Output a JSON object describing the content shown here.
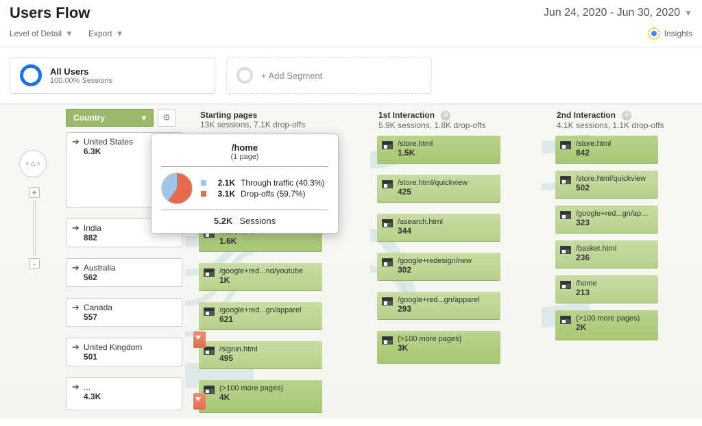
{
  "header": {
    "title": "Users Flow",
    "date_range": "Jun 24, 2020 - Jun 30, 2020"
  },
  "toolbar": {
    "level_of_detail": "Level of Detail",
    "export": "Export",
    "insights": "Insights"
  },
  "segments": {
    "all_users": "All Users",
    "all_users_sub": "100.00% Sessions",
    "add_segment": "+ Add Segment"
  },
  "dimension": {
    "label": "Country"
  },
  "sources": [
    {
      "name": "United States",
      "value": "6.3K"
    },
    {
      "name": "India",
      "value": "882"
    },
    {
      "name": "Australia",
      "value": "562"
    },
    {
      "name": "Canada",
      "value": "557"
    },
    {
      "name": "United Kingdom",
      "value": "501"
    },
    {
      "name": "...",
      "value": "4.3K"
    }
  ],
  "columns": {
    "start": {
      "title": "Starting pages",
      "sub": "13K sessions, 7.1K drop-offs",
      "items": [
        {
          "label": "/store.html",
          "value": "1.6K"
        },
        {
          "label": "/google+red...nd/youtube",
          "value": "1K"
        },
        {
          "label": "/google+red...gn/apparel",
          "value": "621"
        },
        {
          "label": "/signin.html",
          "value": "495"
        },
        {
          "label": "(>100 more pages)",
          "value": "4K"
        }
      ]
    },
    "first": {
      "title": "1st Interaction",
      "sub": "5.9K sessions, 1.8K drop-offs",
      "items": [
        {
          "label": "/store.html",
          "value": "1.5K"
        },
        {
          "label": "/store.html/quickview",
          "value": "425"
        },
        {
          "label": "/asearch.html",
          "value": "344"
        },
        {
          "label": "/google+redesign/new",
          "value": "302"
        },
        {
          "label": "/google+red...gn/apparel",
          "value": "293"
        },
        {
          "label": "(>100 more pages)",
          "value": "3K"
        }
      ]
    },
    "second": {
      "title": "2nd Interaction",
      "sub": "4.1K sessions, 1.1K drop-offs",
      "items": [
        {
          "label": "/store.html",
          "value": "842"
        },
        {
          "label": "/store.html/quickview",
          "value": "502"
        },
        {
          "label": "/google+red...gn/apparel",
          "value": "323"
        },
        {
          "label": "/basket.html",
          "value": "236"
        },
        {
          "label": "/home",
          "value": "213"
        },
        {
          "label": "(>100 more pages)",
          "value": "2K"
        }
      ]
    }
  },
  "hover": {
    "title": "/home",
    "subtitle": "(1 page)",
    "through_value": "2.1K",
    "through_label": "Through traffic (40.3%)",
    "drop_value": "3.1K",
    "drop_label": "Drop-offs (59.7%)",
    "sessions_value": "5.2K",
    "sessions_label": "Sessions"
  }
}
